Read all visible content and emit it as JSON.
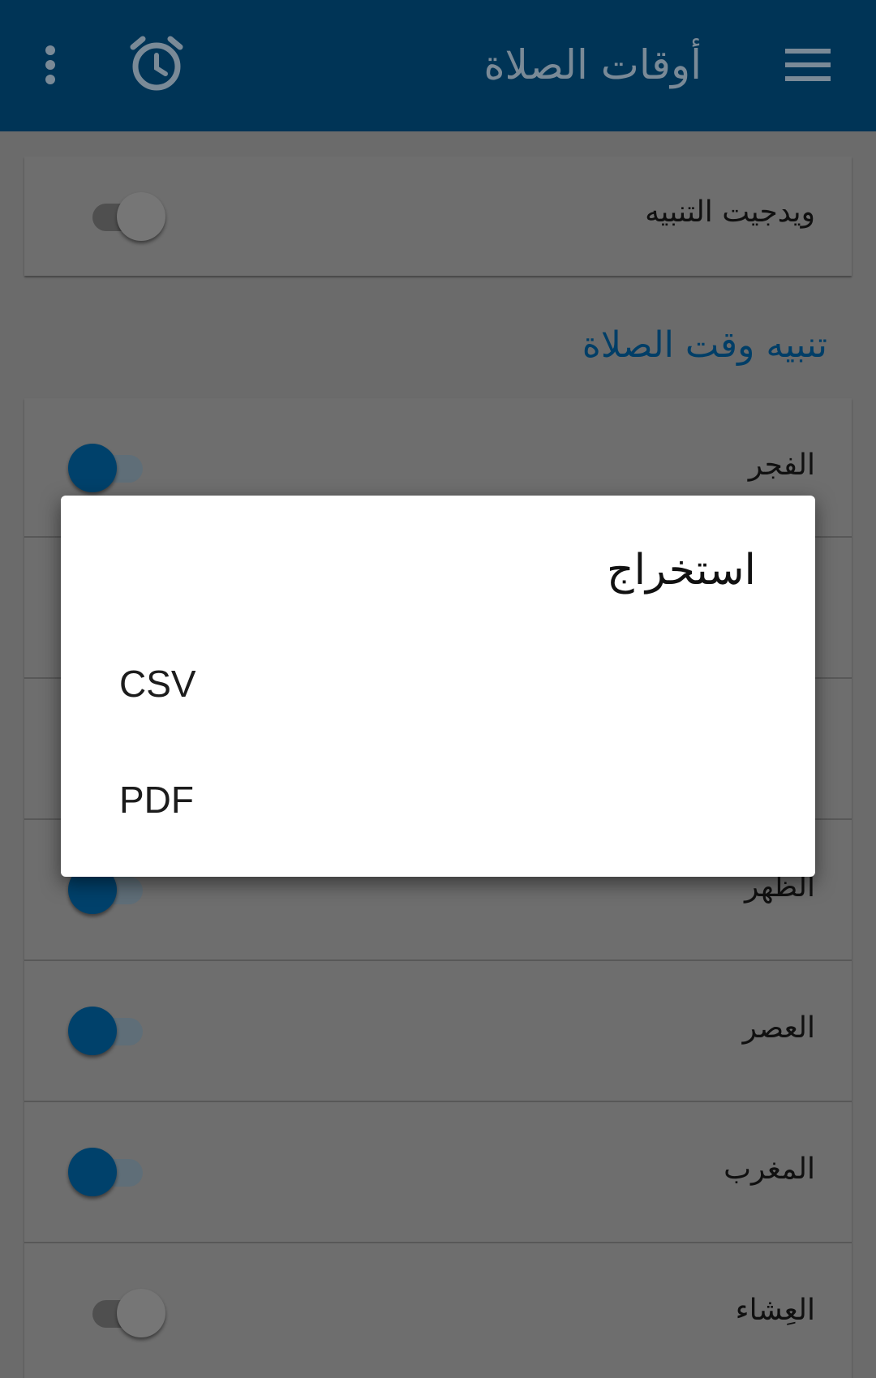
{
  "app_bar": {
    "title": "أوقات الصلاة",
    "menu_icon": "hamburger-menu-icon",
    "alarm_icon": "alarm-clock-icon",
    "overflow_icon": "more-vert-icon",
    "background_color": "#003456"
  },
  "widget_row": {
    "label": "ويدجيت التنبيه",
    "toggle_state": "off"
  },
  "section": {
    "header": "تنبيه وقت الصلاة"
  },
  "prayers": [
    {
      "label": "الفجر",
      "toggle_state": "on"
    },
    {
      "label": "الظهر",
      "toggle_state": "on"
    },
    {
      "label": "العصر",
      "toggle_state": "on"
    },
    {
      "label": "المغرب",
      "toggle_state": "on"
    },
    {
      "label": "العِشاء",
      "toggle_state": "off"
    }
  ],
  "dialog": {
    "title": "استخراج",
    "options": [
      "CSV",
      "PDF"
    ]
  },
  "colors": {
    "accent": "#00416b",
    "scrim_background": "#6b6b6b",
    "dialog_background": "#ffffff"
  }
}
